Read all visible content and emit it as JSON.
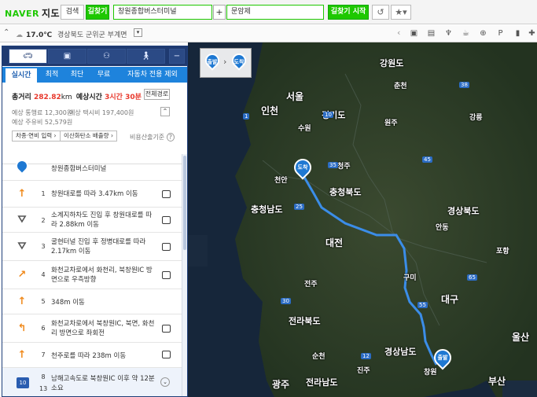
{
  "app": {
    "logo": "NAVER",
    "name": "지도"
  },
  "topbar": {
    "search_label": "검색",
    "route_label": "길찾기",
    "origin": "창원종합버스터미널",
    "plus": "+",
    "destination": "문암제",
    "start_label": "길찾기 시작"
  },
  "weather": {
    "temp": "17.0℃",
    "location": "경상북도 군위군 부계면"
  },
  "modes": [
    "car",
    "bus",
    "bike",
    "walk"
  ],
  "tabs": [
    "실시간",
    "최적",
    "최단",
    "무료",
    "자동차 전용 제외"
  ],
  "summary": {
    "dist_label": "총거리",
    "dist_value": "282.82",
    "dist_unit": "km",
    "time_label": "예상시간",
    "time_value": "3시간 30분",
    "all_route": "전체경로",
    "toll_label": "예상 통행료",
    "toll_value": "12,300원",
    "taxi_label": "예상 택시비",
    "taxi_value": "197,400원",
    "fuel_label": "예상 주유비",
    "fuel_value": "52,579원",
    "btn_fuel": "차종·연비 입력 ›",
    "btn_co2": "이산화탄소 배출량 ›",
    "cost_info": "비용산출기준"
  },
  "origin_step": {
    "text": "창원종합버스터미널"
  },
  "steps": [
    {
      "num": "1",
      "text": "창원대로를 따라 3.47km 이동"
    },
    {
      "num": "2",
      "text": "소계지하차도 진입 후 창원대로를 따라 2.88km 이동"
    },
    {
      "num": "3",
      "text": "굴현터널 진입 후 정병대로를 따라 2.17km 이동"
    },
    {
      "num": "4",
      "text": "화천교차로에서 화천리, 북창원IC 방면으로 우측방향"
    },
    {
      "num": "5",
      "text": "348m 이동"
    },
    {
      "num": "6",
      "text": "화천교차로에서 북창원IC, 북면, 화천리 방면으로 좌회전"
    },
    {
      "num": "7",
      "text": "천주로를 따라 238m 이동"
    },
    {
      "num": "8",
      "num2": "13",
      "badge": "10",
      "text": "남해고속도로 북창원IC 이후 약 12분 소요"
    }
  ],
  "map": {
    "depart": "출발",
    "arrive": "도착",
    "regions": [
      "강원도",
      "경기도",
      "충청북도",
      "충청남도",
      "경상북도",
      "전라북도",
      "경상남도",
      "전라남도"
    ],
    "cities": [
      "서울",
      "인천",
      "수원",
      "대전",
      "대구",
      "울산",
      "광주",
      "부산",
      "강릉",
      "청주",
      "전주",
      "포항",
      "창원",
      "안동",
      "원주",
      "춘천",
      "천안",
      "진주",
      "구미",
      "순천"
    ],
    "road_numbers": [
      "1",
      "10",
      "25",
      "35",
      "45",
      "55",
      "65",
      "12",
      "30",
      "38"
    ]
  }
}
